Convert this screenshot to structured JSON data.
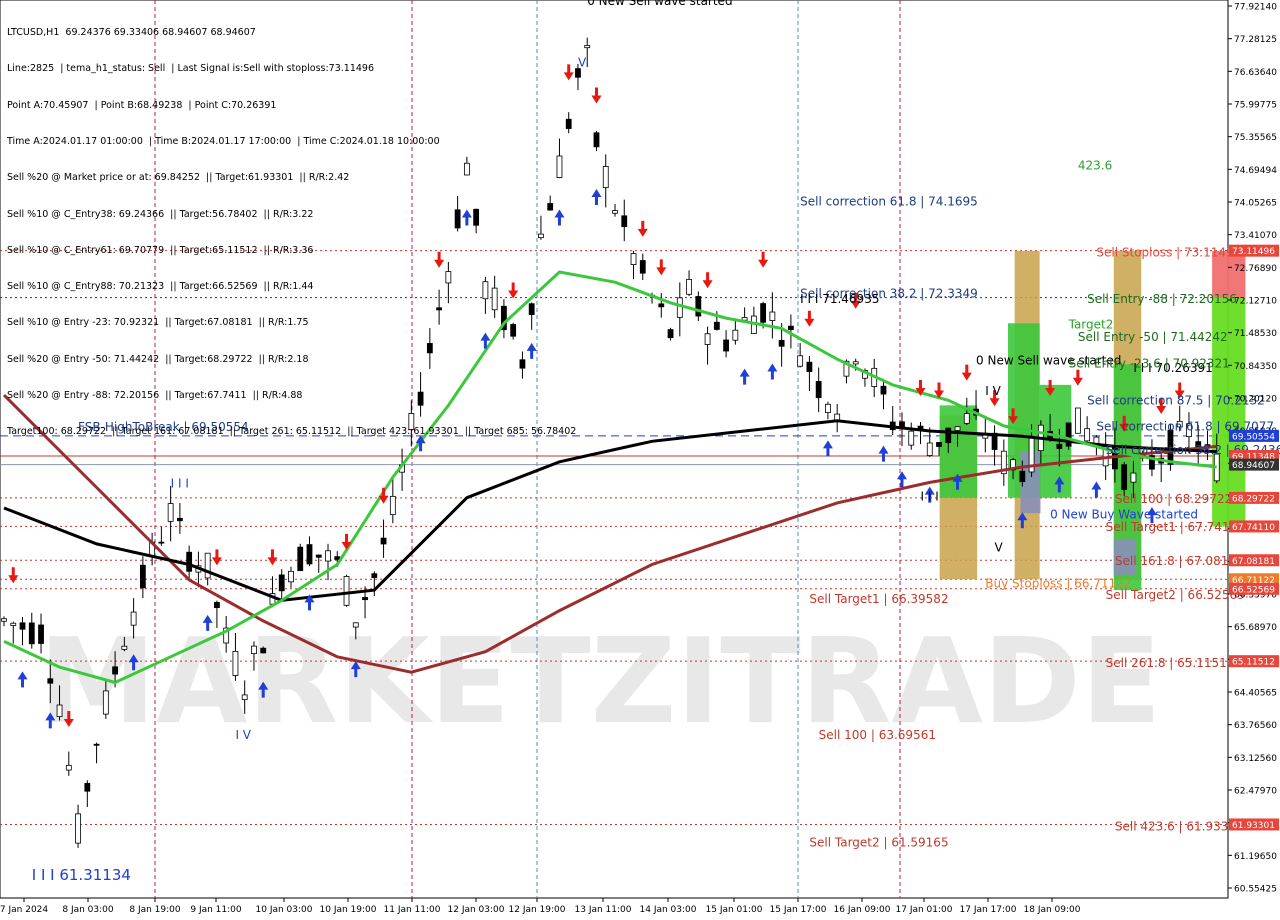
{
  "info_lines": [
    "LTCUSD,H1  69.24376 69.33406 68.94607 68.94607",
    "Line:2825  | tema_h1_status: Sell  | Last Signal is:Sell with stoploss:73.11496",
    "Point A:70.45907  | Point B:68.49238  | Point C:70.26391",
    "Time A:2024.01.17 01:00:00  | Time B:2024.01.17 17:00:00  | Time C:2024.01.18 10:00:00",
    "Sell %20 @ Market price or at: 69.84252  || Target:61.93301  || R/R:2.42",
    "Sell %10 @ C_Entry38: 69.24366  || Target:56.78402  || R/R:3.22",
    "Sell %10 @ C_Entry61: 69.70779  || Target:65.11512  || R/R:3.36",
    "Sell %10 @ C_Entry88: 70.21323  || Target:66.52569  || R/R:1.44",
    "Sell %10 @ Entry -23: 70.92321  || Target:67.08181  || R/R:1.75",
    "Sell %20 @ Entry -50: 71.44242  || Target:68.29722  || R/R:2.18",
    "Sell %20 @ Entry -88: 72.20156  || Target:67.7411  || R/R:4.88",
    "Target100: 68.29722  || Target 161: 67.08181  || Target 261: 65.11512  || Target 423: 61.93301  || Target 685: 56.78402"
  ],
  "chart_data": {
    "type": "candlestick",
    "symbol": "LTCUSD",
    "timeframe": "H1",
    "ohlc_last": {
      "open": 69.24376,
      "high": 69.33406,
      "low": 68.94607,
      "close": 68.94607
    },
    "ylim": [
      60.5,
      78.0
    ],
    "y_ticks": [
      "77.92140",
      "77.28125",
      "76.63640",
      "75.99775",
      "75.35565",
      "74.69494",
      "74.05265",
      "73.41070",
      "72.76890",
      "72.12710",
      "71.48530",
      "70.84350",
      "70.20120",
      "69.55820",
      "68.91640",
      "68.27460",
      "67.63280",
      "66.99100",
      "66.33970",
      "65.68970",
      "65.04500",
      "64.40565",
      "63.76560",
      "63.12560",
      "62.47970",
      "61.83970",
      "61.19650",
      "60.55425"
    ],
    "x_ticks": [
      "7 Jan 2024",
      "8 Jan 03:00",
      "8 Jan 19:00",
      "9 Jan 11:00",
      "10 Jan 03:00",
      "10 Jan 19:00",
      "11 Jan 11:00",
      "12 Jan 03:00",
      "12 Jan 19:00",
      "13 Jan 11:00",
      "14 Jan 03:00",
      "15 Jan 01:00",
      "15 Jan 17:00",
      "16 Jan 09:00",
      "17 Jan 01:00",
      "17 Jan 17:00",
      "18 Jan 09:00"
    ],
    "price_tags": [
      {
        "text": "73.11496",
        "value": 73.11496,
        "color": "#e8463a"
      },
      {
        "text": "69.50554",
        "value": 69.50554,
        "color": "#1f3fd6"
      },
      {
        "text": "69.11348",
        "value": 69.11348,
        "color": "#e8463a"
      },
      {
        "text": "68.94607",
        "value": 68.94607,
        "color": "#333333"
      },
      {
        "text": "68.29722",
        "value": 68.29722,
        "color": "#e8463a"
      },
      {
        "text": "67.74110",
        "value": 67.7411,
        "color": "#e8463a"
      },
      {
        "text": "67.08181",
        "value": 67.08181,
        "color": "#e8463a"
      },
      {
        "text": "66.71122",
        "value": 66.71122,
        "color": "#ee7a2a"
      },
      {
        "text": "66.52569",
        "value": 66.52569,
        "color": "#e8463a"
      },
      {
        "text": "65.11512",
        "value": 65.11512,
        "color": "#e8463a"
      },
      {
        "text": "61.93301",
        "value": 61.93301,
        "color": "#e8463a"
      }
    ],
    "levels": [
      {
        "value": 73.11496,
        "style": "red-dotted"
      },
      {
        "value": 72.2,
        "style": "blue-dotted"
      },
      {
        "value": 69.50554,
        "style": "blue-dashed"
      },
      {
        "value": 69.11348,
        "style": "red-solid"
      },
      {
        "value": 68.94607,
        "style": "gray-solid"
      },
      {
        "value": 68.29722,
        "style": "red-dotted"
      },
      {
        "value": 67.7411,
        "style": "red-dotted"
      },
      {
        "value": 67.08181,
        "style": "red-dotted"
      },
      {
        "value": 66.71122,
        "style": "red-dotted"
      },
      {
        "value": 66.52569,
        "style": "red-dotted"
      },
      {
        "value": 65.11512,
        "style": "red-dotted"
      },
      {
        "value": 61.93301,
        "style": "red-dotted"
      }
    ],
    "annotations": [
      {
        "text": "0 New Sell wave started",
        "x_index": 63,
        "value": 77.9,
        "color": "#000000"
      },
      {
        "text": "Sell correction 61.8 | 74.1695",
        "x_index": 86,
        "value": 74.0,
        "color": "#1e3c82"
      },
      {
        "text": "Sell correction 38.2 | 72.3349",
        "x_index": 86,
        "value": 72.2,
        "color": "#1e3c82"
      },
      {
        "text": "I I I 71.46935",
        "x_index": 86,
        "value": 72.1,
        "color": "#000000"
      },
      {
        "text": "FSB-HighToBreak | 69.50554",
        "x_index": 8,
        "value": 69.6,
        "color": "#1e3c82"
      },
      {
        "text": "423.6",
        "x_index": 116,
        "value": 74.7,
        "color": "#2ca02c"
      },
      {
        "text": "0 New Sell wave started",
        "x_index": 105,
        "value": 70.9,
        "color": "#000000"
      },
      {
        "text": "Sell Stoploss | 73.11496",
        "x_index": 118,
        "value": 73.0,
        "color": "#e8463a"
      },
      {
        "text": "Sell Entry -88 | 72.20156",
        "x_index": 117,
        "value": 72.1,
        "color": "#1f6b1f"
      },
      {
        "text": "Target2",
        "x_index": 115,
        "value": 71.6,
        "color": "#2ca02c"
      },
      {
        "text": "Sell Entry -50 | 71.44242",
        "x_index": 116,
        "value": 71.35,
        "color": "#1f6b1f"
      },
      {
        "text": "I I I 70.26391",
        "x_index": 122,
        "value": 70.75,
        "color": "#000000"
      },
      {
        "text": "Sell Entry -23.6 | 70.92321",
        "x_index": 115,
        "value": 70.84,
        "color": "#1f6b1f"
      },
      {
        "text": "Sell correction 87.5 | 70.2132",
        "x_index": 117,
        "value": 70.12,
        "color": "#1e3c82"
      },
      {
        "text": "Sell correction 61.8 | 69.7077",
        "x_index": 118,
        "value": 69.61,
        "color": "#1e3c82"
      },
      {
        "text": "Sell correction 38.2 | 69.2436",
        "x_index": 119,
        "value": 69.15,
        "color": "#1e3c82"
      },
      {
        "text": "Sell 100 | 68.29722",
        "x_index": 120,
        "value": 68.2,
        "color": "#c0392b"
      },
      {
        "text": "0 New Buy Wave started",
        "x_index": 113,
        "value": 67.9,
        "color": "#1f3fd6"
      },
      {
        "text": "Sell Target1 | 67.7411",
        "x_index": 119,
        "value": 67.65,
        "color": "#c0392b"
      },
      {
        "text": "Sell 161.8 | 67.08181",
        "x_index": 120,
        "value": 66.99,
        "color": "#c0392b"
      },
      {
        "text": "Buy Stoploss | 66.71122",
        "x_index": 106,
        "value": 66.55,
        "color": "#ee7a2a"
      },
      {
        "text": "Sell Target2 | 66.52569",
        "x_index": 119,
        "value": 66.33,
        "color": "#c0392b"
      },
      {
        "text": "Sell Target1 | 66.39582",
        "x_index": 87,
        "value": 66.25,
        "color": "#c0392b"
      },
      {
        "text": "Sell 261.8 | 65.11512",
        "x_index": 119,
        "value": 65.0,
        "color": "#c0392b"
      },
      {
        "text": "Sell 100 | 63.69561",
        "x_index": 88,
        "value": 63.6,
        "color": "#c0392b"
      },
      {
        "text": "Sell Target2 | 61.59165",
        "x_index": 87,
        "value": 61.5,
        "color": "#c0392b"
      },
      {
        "text": "Sell 423.6 | 61.93301",
        "x_index": 120,
        "value": 61.82,
        "color": "#c0392b"
      },
      {
        "text": "I I I 61.31134",
        "x_index": 3,
        "value": 60.85,
        "color": "#1f3fd6"
      },
      {
        "text": "I V",
        "x_index": 25,
        "value": 63.6,
        "color": "#1f3fd6"
      },
      {
        "text": "I I I",
        "x_index": 18,
        "value": 68.5,
        "color": "#1f3fd6"
      },
      {
        "text": "V",
        "x_index": 62,
        "value": 76.7,
        "color": "#1f3fd6"
      },
      {
        "text": "I I I",
        "x_index": 99,
        "value": 68.25,
        "color": "#000000"
      },
      {
        "text": "V",
        "x_index": 107,
        "value": 67.25,
        "color": "#000000"
      },
      {
        "text": "I V",
        "x_index": 106,
        "value": 70.3,
        "color": "#000000"
      }
    ],
    "watermark": "MARKETZITRADE"
  }
}
